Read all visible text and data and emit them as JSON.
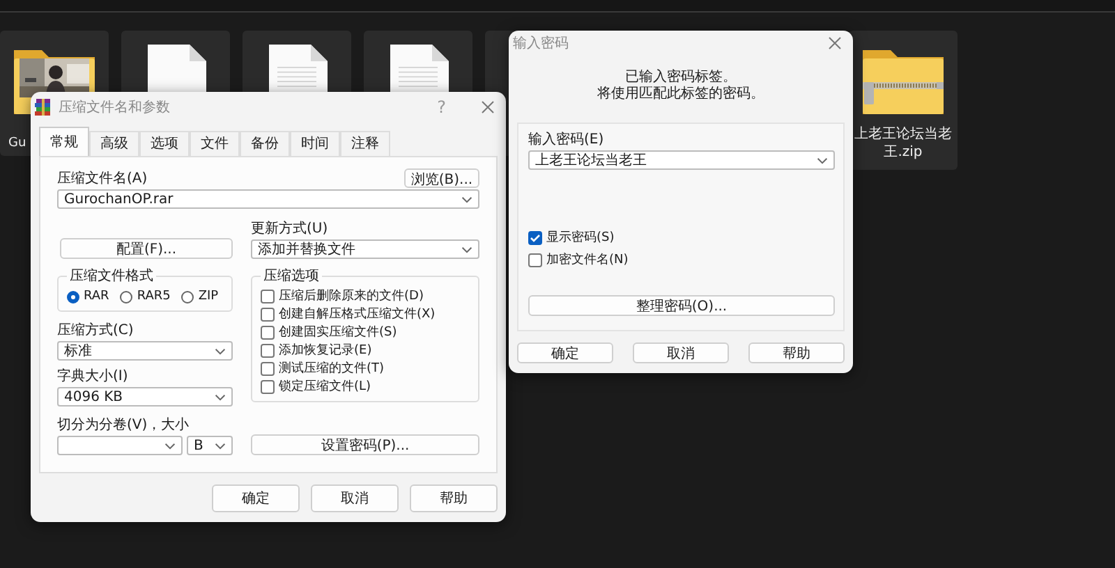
{
  "desktop": {
    "files": [
      {
        "kind": "photo_folder",
        "label": "Gu"
      },
      {
        "kind": "blank_document"
      },
      {
        "kind": "text_document"
      },
      {
        "kind": "text_document"
      },
      {
        "kind": "tile"
      },
      {
        "kind": "zip_folder",
        "label": "上老王论坛当老王.zip"
      }
    ]
  },
  "archive_dialog": {
    "title": "压缩文件名和参数",
    "help_glyph": "?",
    "tabs": [
      {
        "label": "常规",
        "selected": true
      },
      {
        "label": "高级",
        "selected": false
      },
      {
        "label": "选项",
        "selected": false
      },
      {
        "label": "文件",
        "selected": false
      },
      {
        "label": "备份",
        "selected": false
      },
      {
        "label": "时间",
        "selected": false
      },
      {
        "label": "注释",
        "selected": false
      }
    ],
    "archive_name": {
      "label": "压缩文件名(A)",
      "value": "GurochanOP.rar"
    },
    "browse_button": "浏览(B)...",
    "profiles_button": "配置(F)...",
    "update_mode": {
      "label": "更新方式(U)",
      "value": "添加并替换文件"
    },
    "format": {
      "title": "压缩文件格式",
      "options": [
        {
          "label": "RAR",
          "selected": true
        },
        {
          "label": "RAR5",
          "selected": false
        },
        {
          "label": "ZIP",
          "selected": false
        }
      ]
    },
    "method": {
      "label": "压缩方式(C)",
      "value": "标准"
    },
    "dictionary": {
      "label": "字典大小(I)",
      "value": "4096 KB"
    },
    "split": {
      "label": "切分为分卷(V)，大小",
      "unit": "B"
    },
    "options": {
      "title": "压缩选项",
      "items": [
        {
          "label": "压缩后删除原来的文件(D)",
          "checked": false
        },
        {
          "label": "创建自解压格式压缩文件(X)",
          "checked": false
        },
        {
          "label": "创建固实压缩文件(S)",
          "checked": false
        },
        {
          "label": "添加恢复记录(E)",
          "checked": false
        },
        {
          "label": "测试压缩的文件(T)",
          "checked": false
        },
        {
          "label": "锁定压缩文件(L)",
          "checked": false
        }
      ]
    },
    "set_password_button": "设置密码(P)...",
    "buttons": [
      "确定",
      "取消",
      "帮助"
    ]
  },
  "password_dialog": {
    "title": "输入密码",
    "message": [
      "已输入密码标签。",
      "将使用匹配此标签的密码。"
    ],
    "password": {
      "label": "输入密码(E)",
      "value": "上老王论坛当老王"
    },
    "options": [
      {
        "label": "显示密码(S)",
        "checked": true
      },
      {
        "label": "加密文件名(N)",
        "checked": false
      }
    ],
    "organize_button": "整理密码(O)...",
    "buttons": [
      "确定",
      "取消",
      "帮助"
    ]
  }
}
